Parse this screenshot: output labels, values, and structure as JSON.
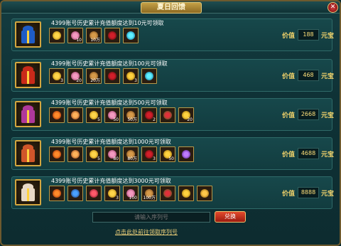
{
  "window": {
    "title": "夏日回馈",
    "close_icon": "close-icon"
  },
  "colors": {
    "gold": "#f2d36b",
    "panel": "#123c3f",
    "accent_red": "#c82a1a"
  },
  "tiers": [
    {
      "requirement": "4399账号历史累计充值额度达到10元可领取",
      "value_label": "价值",
      "value": "188",
      "unit": "元宝",
      "gift_color": "#1f5cc6",
      "items": [
        {
          "icon": "gold-orb-icon",
          "count": ""
        },
        {
          "icon": "pink-gem-icon",
          "count": "10"
        },
        {
          "icon": "copper-coin-icon",
          "count": "10万"
        },
        {
          "icon": "rose-icon",
          "count": ""
        },
        {
          "icon": "blue-orb-icon",
          "count": ""
        }
      ]
    },
    {
      "requirement": "4399账号历史累计充值额度达到100元可领取",
      "value_label": "价值",
      "value": "468",
      "unit": "元宝",
      "gift_color": "#c82a1a",
      "items": [
        {
          "icon": "gold-orb-icon",
          "count": "3"
        },
        {
          "icon": "pink-gem-icon",
          "count": "20"
        },
        {
          "icon": "copper-coin-icon",
          "count": "20万"
        },
        {
          "icon": "rose-icon",
          "count": ""
        },
        {
          "icon": "gold-bar-icon",
          "count": "3"
        },
        {
          "icon": "blue-orb-icon",
          "count": ""
        }
      ]
    },
    {
      "requirement": "4399账号历史累计充值额度达到500元可领取",
      "value_label": "价值",
      "value": "2668",
      "unit": "元宝",
      "gift_color": "#b0389a",
      "items": [
        {
          "icon": "fire-orb-icon",
          "count": ""
        },
        {
          "icon": "dragon-token-icon",
          "count": ""
        },
        {
          "icon": "gold-orb-icon",
          "count": "5"
        },
        {
          "icon": "pink-gem-icon",
          "count": "50"
        },
        {
          "icon": "copper-coin-icon",
          "count": "50万"
        },
        {
          "icon": "rose-icon",
          "count": "2"
        },
        {
          "icon": "rose-bouquet-icon",
          "count": ""
        },
        {
          "icon": "gold-bar-icon",
          "count": "20"
        }
      ]
    },
    {
      "requirement": "4399账号历史累计充值额度达到1000元可领取",
      "value_label": "价值",
      "value": "4688",
      "unit": "元宝",
      "gift_color": "#d0562a",
      "items": [
        {
          "icon": "fire-orb-icon",
          "count": ""
        },
        {
          "icon": "dragon-token-icon",
          "count": ""
        },
        {
          "icon": "gold-orb-icon",
          "count": "5"
        },
        {
          "icon": "pink-gem-icon",
          "count": "80"
        },
        {
          "icon": "copper-coin-icon",
          "count": "80万"
        },
        {
          "icon": "rose-icon",
          "count": "3"
        },
        {
          "icon": "gold-bar-icon",
          "count": "50"
        },
        {
          "icon": "purple-orb-icon",
          "count": ""
        }
      ]
    },
    {
      "requirement": "4399账号历史累计充值额度达到3000元可领取",
      "value_label": "价值",
      "value": "8888",
      "unit": "元宝",
      "gift_color": "#e8d9c6",
      "items": [
        {
          "icon": "fire-orb-icon",
          "count": ""
        },
        {
          "icon": "blue-armor-icon",
          "count": ""
        },
        {
          "icon": "red-gem-icon",
          "count": ""
        },
        {
          "icon": "gold-orb-icon",
          "count": "3"
        },
        {
          "icon": "pink-gem-icon",
          "count": "100"
        },
        {
          "icon": "copper-coin-icon",
          "count": "100万"
        },
        {
          "icon": "rose-bouquet-icon",
          "count": ""
        },
        {
          "icon": "gold-bar-icon",
          "count": ""
        },
        {
          "icon": "gold-ring-icon",
          "count": ""
        }
      ]
    }
  ],
  "serial_input": {
    "placeholder": "请输入序列号"
  },
  "redeem_button": {
    "label": "兑换"
  },
  "get_serial_link": {
    "label": "点击此处前往领取序列号"
  }
}
